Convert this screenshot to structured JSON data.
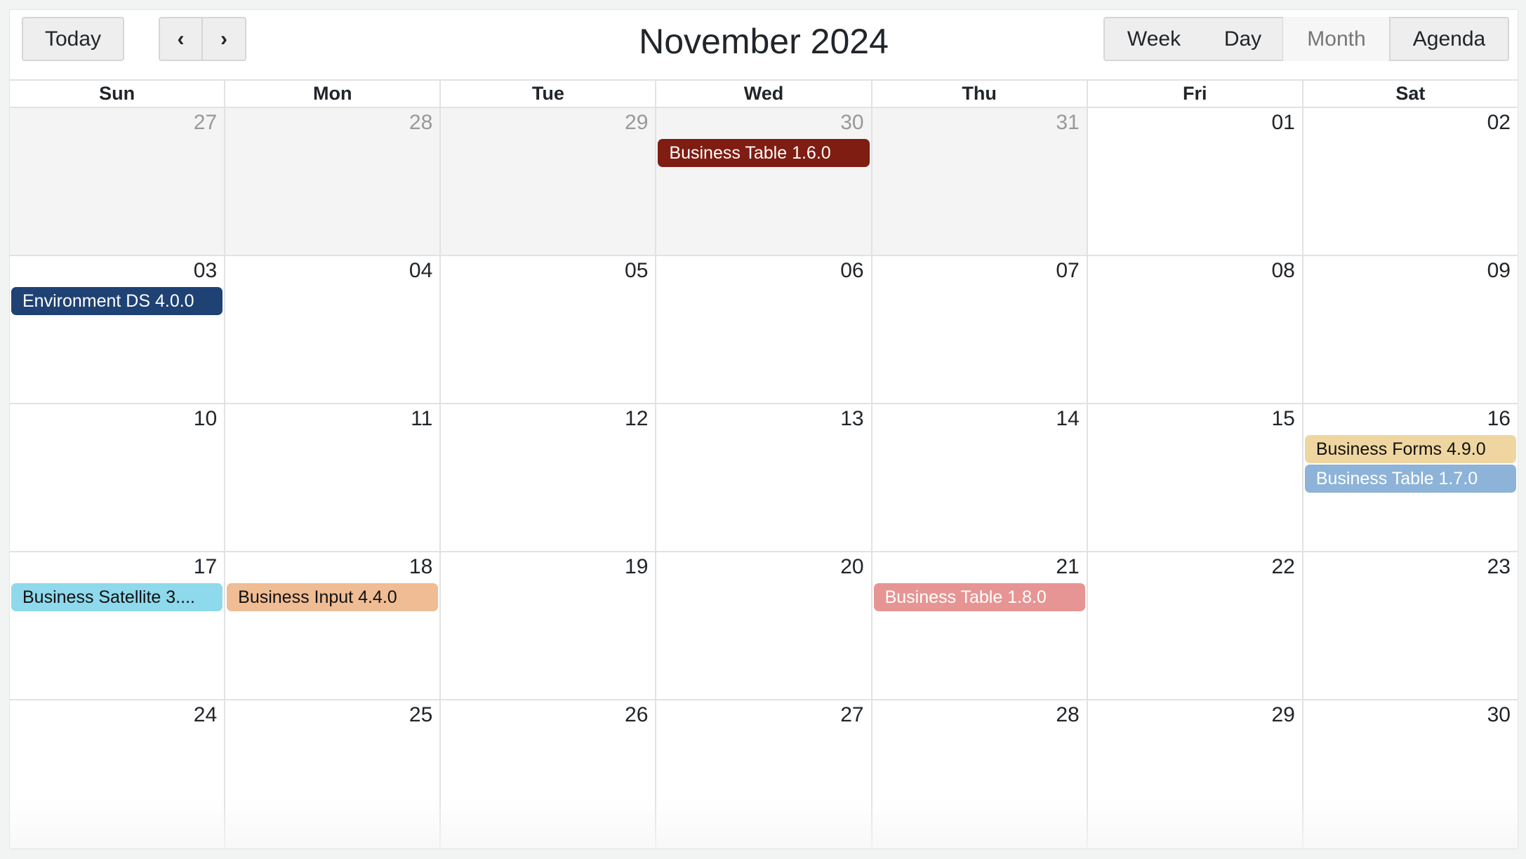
{
  "toolbar": {
    "today_label": "Today",
    "prev_label": "‹",
    "next_label": "›",
    "title": "November 2024",
    "views": [
      {
        "label": "Week",
        "active": false
      },
      {
        "label": "Day",
        "active": false
      },
      {
        "label": "Month",
        "active": true
      },
      {
        "label": "Agenda",
        "active": false
      }
    ]
  },
  "weekdays": [
    "Sun",
    "Mon",
    "Tue",
    "Wed",
    "Thu",
    "Fri",
    "Sat"
  ],
  "weeks": [
    [
      {
        "date": "27",
        "off": true,
        "events": []
      },
      {
        "date": "28",
        "off": true,
        "events": []
      },
      {
        "date": "29",
        "off": true,
        "events": []
      },
      {
        "date": "30",
        "off": true,
        "events": [
          {
            "title": "Business Table 1.6.0",
            "bg": "#7f1d12",
            "fg": "#ffffff"
          }
        ]
      },
      {
        "date": "31",
        "off": true,
        "events": []
      },
      {
        "date": "01",
        "off": false,
        "events": []
      },
      {
        "date": "02",
        "off": false,
        "events": []
      }
    ],
    [
      {
        "date": "03",
        "off": false,
        "events": [
          {
            "title": "Environment DS 4.0.0",
            "bg": "#1f4275",
            "fg": "#ffffff"
          }
        ]
      },
      {
        "date": "04",
        "off": false,
        "events": []
      },
      {
        "date": "05",
        "off": false,
        "events": []
      },
      {
        "date": "06",
        "off": false,
        "events": []
      },
      {
        "date": "07",
        "off": false,
        "events": []
      },
      {
        "date": "08",
        "off": false,
        "events": []
      },
      {
        "date": "09",
        "off": false,
        "events": []
      }
    ],
    [
      {
        "date": "10",
        "off": false,
        "events": []
      },
      {
        "date": "11",
        "off": false,
        "events": []
      },
      {
        "date": "12",
        "off": false,
        "events": []
      },
      {
        "date": "13",
        "off": false,
        "events": []
      },
      {
        "date": "14",
        "off": false,
        "events": []
      },
      {
        "date": "15",
        "off": false,
        "events": []
      },
      {
        "date": "16",
        "off": false,
        "events": [
          {
            "title": "Business Forms 4.9.0",
            "bg": "#efd6a0",
            "fg": "#111111"
          },
          {
            "title": "Business Table 1.7.0",
            "bg": "#8db3d8",
            "fg": "#ffffff"
          }
        ]
      }
    ],
    [
      {
        "date": "17",
        "off": false,
        "events": [
          {
            "title": "Business Satellite 3....",
            "bg": "#8ed9ec",
            "fg": "#111111"
          }
        ]
      },
      {
        "date": "18",
        "off": false,
        "events": [
          {
            "title": "Business Input 4.4.0",
            "bg": "#efbc94",
            "fg": "#111111"
          }
        ]
      },
      {
        "date": "19",
        "off": false,
        "events": []
      },
      {
        "date": "20",
        "off": false,
        "events": []
      },
      {
        "date": "21",
        "off": false,
        "events": [
          {
            "title": "Business Table 1.8.0",
            "bg": "#e69594",
            "fg": "#ffffff"
          }
        ]
      },
      {
        "date": "22",
        "off": false,
        "events": []
      },
      {
        "date": "23",
        "off": false,
        "events": []
      }
    ],
    [
      {
        "date": "24",
        "off": false,
        "events": []
      },
      {
        "date": "25",
        "off": false,
        "events": []
      },
      {
        "date": "26",
        "off": false,
        "events": []
      },
      {
        "date": "27",
        "off": false,
        "events": []
      },
      {
        "date": "28",
        "off": false,
        "events": []
      },
      {
        "date": "29",
        "off": false,
        "events": []
      },
      {
        "date": "30",
        "off": false,
        "events": []
      }
    ]
  ]
}
